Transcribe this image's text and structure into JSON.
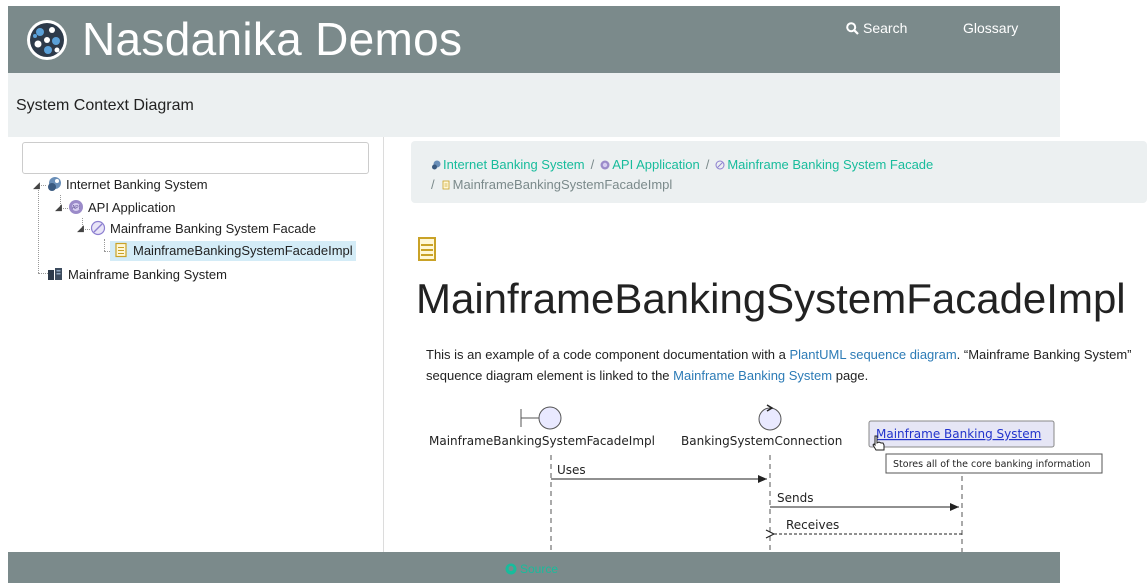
{
  "header": {
    "brand": "Nasdanika Demos",
    "search_label": "Search",
    "glossary_label": "Glossary"
  },
  "titlebar": {
    "title": "System Context Diagram"
  },
  "sidebar": {
    "filter_placeholder": "",
    "tree": [
      {
        "label": "Internet Banking System",
        "icon": "software-system-icon",
        "level": 0
      },
      {
        "label": "API Application",
        "icon": "api-container-icon",
        "level": 1
      },
      {
        "label": "Mainframe Banking System Facade",
        "icon": "component-icon",
        "level": 2
      },
      {
        "label": "MainframeBankingSystemFacadeImpl",
        "icon": "code-file-icon",
        "level": 3,
        "selected": true
      },
      {
        "label": "Mainframe Banking System",
        "icon": "mainframe-icon",
        "level": 0
      }
    ]
  },
  "breadcrumb": {
    "items": [
      "Internet Banking System",
      "API Application",
      "Mainframe Banking System Facade"
    ],
    "current": "MainframeBankingSystemFacadeImpl"
  },
  "main": {
    "title": "MainframeBankingSystemFacadeImpl",
    "desc_part1": "This is an example of a code component documentation with a ",
    "desc_link1": "PlantUML sequence diagram",
    "desc_part2": ". “Mainframe Banking System” sequence diagram element is linked to the ",
    "desc_link2": "Mainframe Banking System",
    "desc_part3": " page."
  },
  "diagram": {
    "participants": [
      "MainframeBankingSystemFacadeImpl",
      "BankingSystemConnection",
      "Mainframe Banking System"
    ],
    "tooltip": "Stores all of the core banking information",
    "messages": [
      "Uses",
      "Sends",
      "Receives"
    ]
  },
  "footer": {
    "source_label": "Source"
  },
  "colors": {
    "header": "#7b8a8b",
    "light": "#ecf0f1",
    "accent": "#18bc9c",
    "link": "#2c7bb6"
  }
}
